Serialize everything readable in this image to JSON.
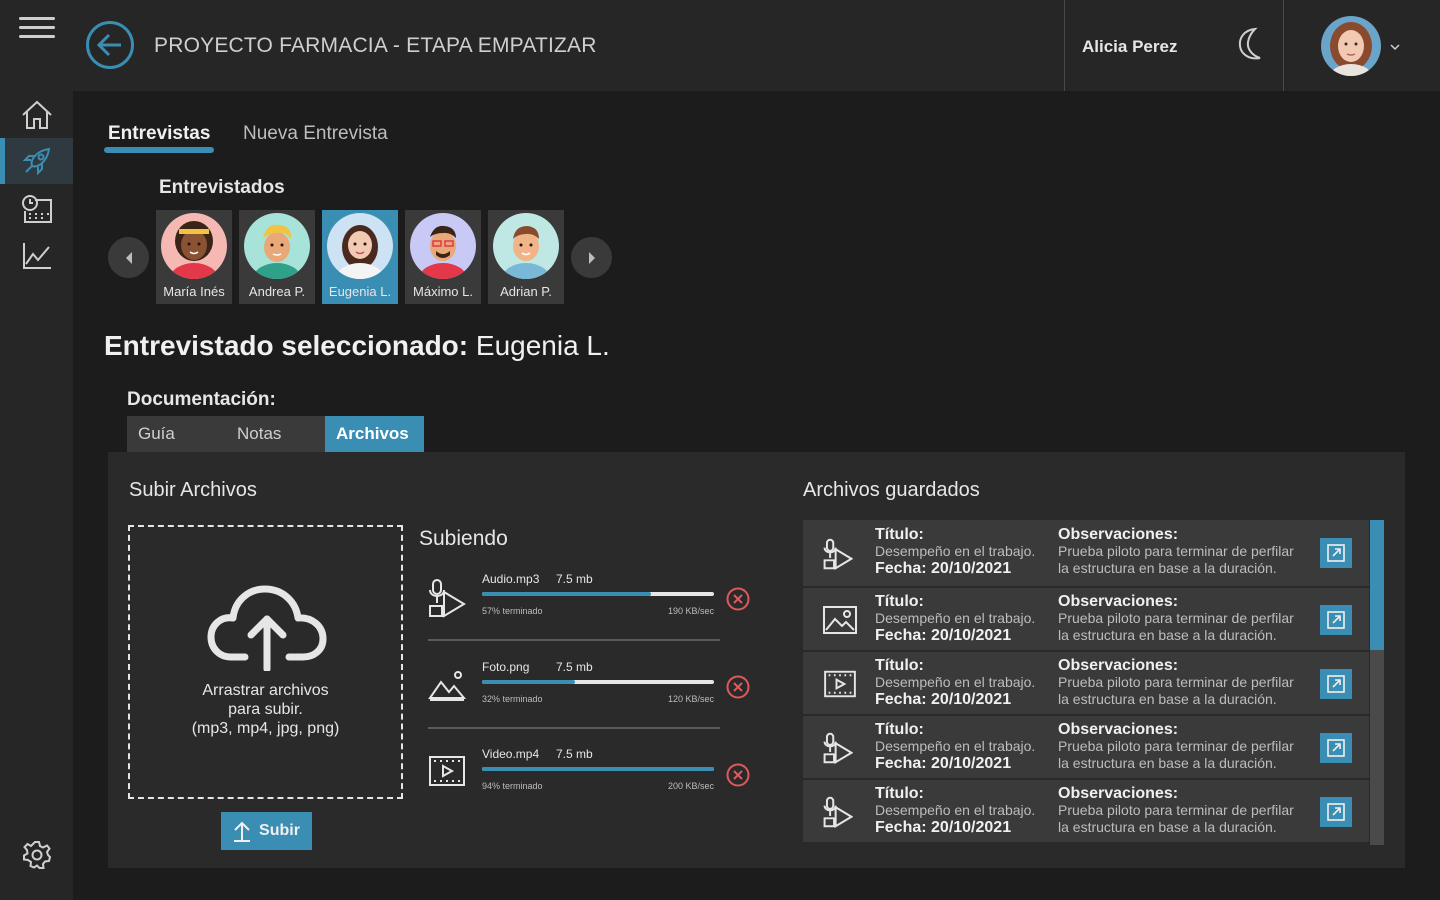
{
  "header": {
    "title": "PROYECTO FARMACIA - ETAPA EMPATIZAR",
    "user_name": "Alicia Perez"
  },
  "tabs": [
    {
      "label": "Entrevistas",
      "active": true
    },
    {
      "label": "Nueva Entrevista",
      "active": false
    }
  ],
  "interviewees": {
    "title": "Entrevistados",
    "people": [
      {
        "name": "María Inés",
        "color": "#f6b8b3",
        "selected": false
      },
      {
        "name": "Andrea P.",
        "color": "#a7e3d8",
        "selected": false
      },
      {
        "name": "Eugenia L.",
        "color": "#cde3f3",
        "selected": true
      },
      {
        "name": "Máximo L.",
        "color": "#c8c9f5",
        "selected": false
      },
      {
        "name": "Adrian P.",
        "color": "#bfe7e3",
        "selected": false
      }
    ]
  },
  "selected": {
    "label": "Entrevistado seleccionado:",
    "name": "Eugenia L."
  },
  "documentation": {
    "title": "Documentación:",
    "tabs": [
      {
        "label": "Guía",
        "active": false
      },
      {
        "label": "Notas",
        "active": false
      },
      {
        "label": "Archivos",
        "active": true
      }
    ]
  },
  "upload": {
    "title": "Subir Archivos",
    "drop_text_1": "Arrastrar archivos",
    "drop_text_2": "para subir.",
    "drop_text_3": "(mp3, mp4, jpg, png)",
    "button_label": "Subir",
    "uploading_title": "Subiendo",
    "items": [
      {
        "name": "Audio.mp3",
        "size": "7.5 mb",
        "progress": 0.73,
        "progress_label": "57% terminado",
        "speed": "190 KB/sec",
        "icon": "audio-file-icon"
      },
      {
        "name": "Foto.png",
        "size": "7.5 mb",
        "progress": 0.4,
        "progress_label": "32% terminado",
        "speed": "120 KB/sec",
        "icon": "image-file-icon"
      },
      {
        "name": "Video.mp4",
        "size": "7.5 mb",
        "progress": 1.0,
        "progress_label": "94% terminado",
        "speed": "200 KB/sec",
        "icon": "video-file-icon"
      }
    ]
  },
  "saved": {
    "title": "Archivos guardados",
    "items": [
      {
        "icon": "audio-file-icon",
        "title_label": "Título:",
        "title_value": "Desempeño en el trabajo.",
        "date": "Fecha: 20/10/2021",
        "obs_label": "Observaciones:",
        "obs_1": "Prueba piloto para terminar de perfilar",
        "obs_2": "la estructura en base a la duración."
      },
      {
        "icon": "image-file-icon",
        "title_label": "Título:",
        "title_value": "Desempeño en el trabajo.",
        "date": "Fecha: 20/10/2021",
        "obs_label": "Observaciones:",
        "obs_1": "Prueba piloto para terminar de perfilar",
        "obs_2": "la estructura en base a la duración."
      },
      {
        "icon": "video-file-icon",
        "title_label": "Título:",
        "title_value": "Desempeño en el trabajo.",
        "date": "Fecha: 20/10/2021",
        "obs_label": "Observaciones:",
        "obs_1": "Prueba piloto para terminar de perfilar",
        "obs_2": "la estructura en base a la duración."
      },
      {
        "icon": "audio-file-icon",
        "title_label": "Título:",
        "title_value": "Desempeño en el trabajo.",
        "date": "Fecha: 20/10/2021",
        "obs_label": "Observaciones:",
        "obs_1": "Prueba piloto para terminar de perfilar",
        "obs_2": "la estructura en base a la duración."
      },
      {
        "icon": "audio-file-icon",
        "title_label": "Título:",
        "title_value": "Desempeño en el trabajo.",
        "date": "Fecha: 20/10/2021",
        "obs_label": "Observaciones:",
        "obs_1": "Prueba piloto para terminar de perfilar",
        "obs_2": "la estructura en base a la duración."
      }
    ]
  },
  "colors": {
    "accent": "#3a8db3",
    "cancel": "#e0595c"
  }
}
